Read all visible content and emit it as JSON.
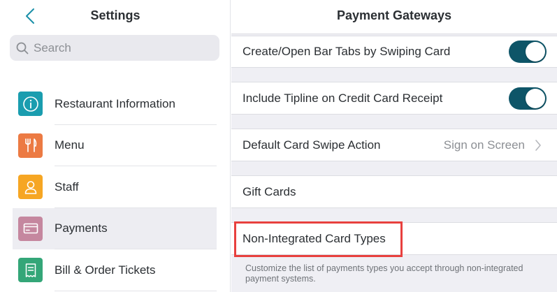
{
  "left": {
    "title": "Settings",
    "search_placeholder": "Search",
    "items": [
      {
        "label": "Restaurant Information",
        "icon": "info-icon",
        "color": "#1a9daf"
      },
      {
        "label": "Menu",
        "icon": "fork-knife-icon",
        "color": "#ec7a43"
      },
      {
        "label": "Staff",
        "icon": "person-icon",
        "color": "#f6a623"
      },
      {
        "label": "Payments",
        "icon": "credit-card-icon",
        "color": "#c5879f",
        "active": true
      },
      {
        "label": "Bill & Order Tickets",
        "icon": "receipt-icon",
        "color": "#34a678"
      }
    ]
  },
  "right": {
    "title": "Payment Gateways",
    "rows": [
      {
        "label": "Create/Open Bar Tabs by Swiping Card",
        "toggle": true
      },
      {
        "label": "Include Tipline on Credit Card Receipt",
        "toggle": true
      },
      {
        "label": "Default Card Swipe Action",
        "value": "Sign on Screen"
      },
      {
        "label": "Gift Cards"
      },
      {
        "label": "Non-Integrated Card Types"
      }
    ],
    "footnote": "Customize the list of payments types you accept through non-integrated payment systems."
  },
  "colors": {
    "toggle_on": "#0e5568",
    "highlight": "#e8403e",
    "accent": "#1a8fa8"
  }
}
